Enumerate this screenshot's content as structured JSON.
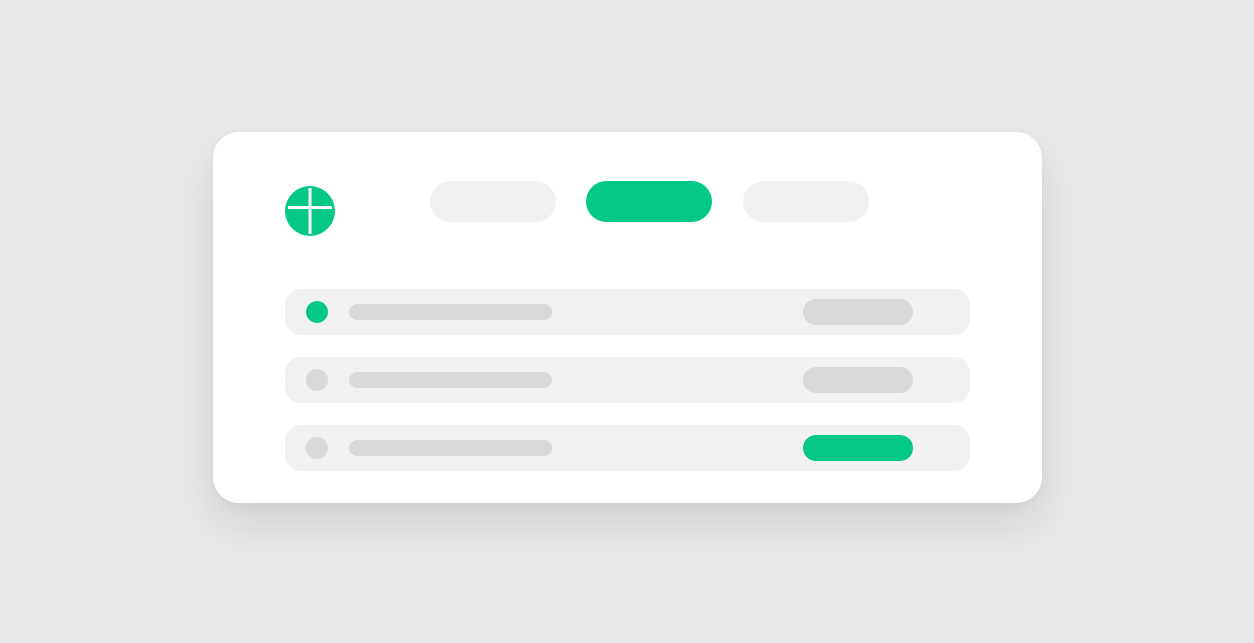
{
  "colors": {
    "background": "#e9e9e9",
    "card": "#ffffff",
    "accent": "#04c984",
    "placeholder_light": "#f1f1f1",
    "placeholder_dark": "#d9d9d9"
  },
  "header": {
    "logo_icon": "plus-circle-logo-icon",
    "tabs": [
      {
        "label": "",
        "active": false
      },
      {
        "label": "",
        "active": true
      },
      {
        "label": "",
        "active": false
      }
    ]
  },
  "list": {
    "rows": [
      {
        "status": "active",
        "text": "",
        "badge": "",
        "badge_active": false
      },
      {
        "status": "inactive",
        "text": "",
        "badge": "",
        "badge_active": false
      },
      {
        "status": "inactive",
        "text": "",
        "badge": "",
        "badge_active": true
      }
    ]
  }
}
